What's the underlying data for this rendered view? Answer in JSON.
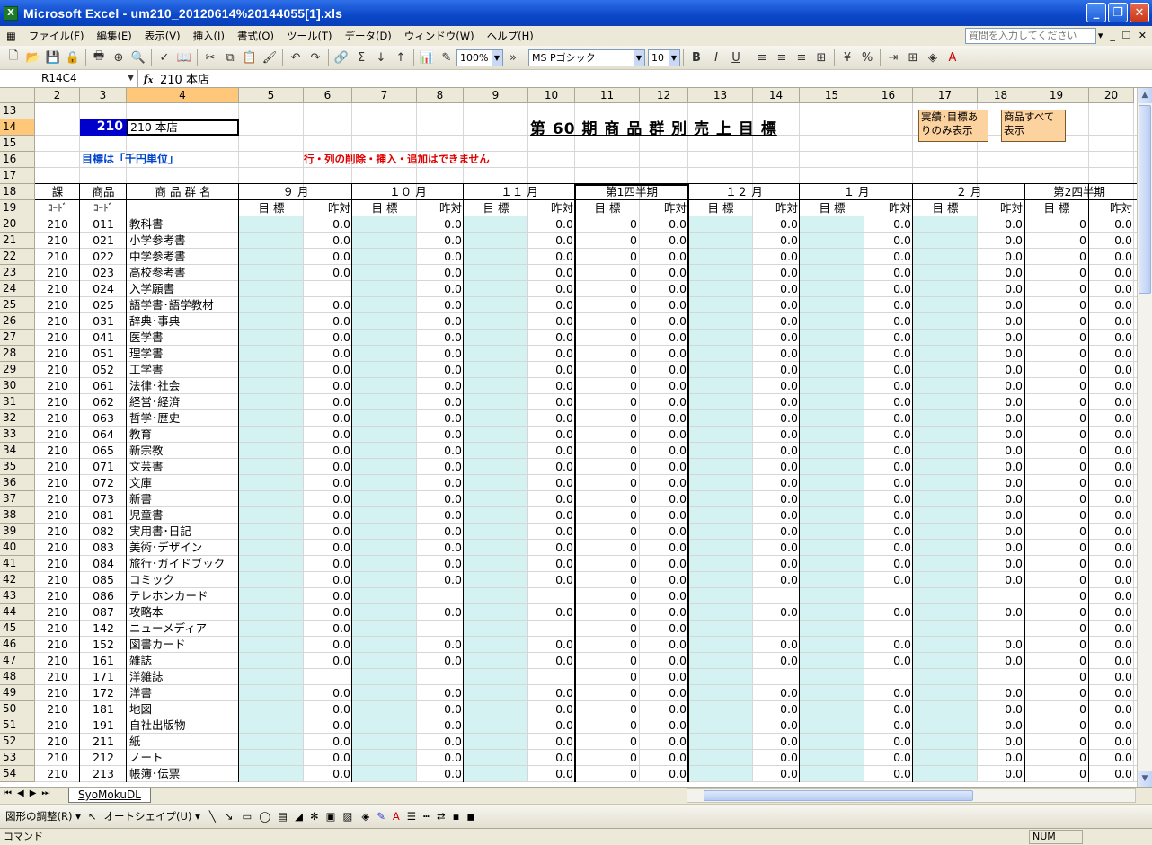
{
  "window": {
    "title": "Microsoft Excel - um210_20120614%20144055[1].xls",
    "app_icon": "excel-icon"
  },
  "menu": {
    "items": [
      "ファイル(F)",
      "編集(E)",
      "表示(V)",
      "挿入(I)",
      "書式(O)",
      "ツール(T)",
      "データ(D)",
      "ウィンドウ(W)",
      "ヘルプ(H)"
    ],
    "ask_placeholder": "質問を入力してください"
  },
  "toolbar": {
    "zoom": "100%",
    "font": "MS Pゴシック",
    "size": "10"
  },
  "formula": {
    "name_box": "R14C4",
    "fx": "fx",
    "value": "210  本店"
  },
  "columns": [
    "2",
    "3",
    "4",
    "5",
    "6",
    "7",
    "8",
    "9",
    "10",
    "11",
    "12",
    "13",
    "14",
    "15",
    "16",
    "17",
    "18",
    "19",
    "20"
  ],
  "sheet": {
    "store_code": "210",
    "store_name": "210  本店",
    "title": "第 60 期   商 品 群 別 売 上 目 標",
    "unit_note": "目標は「千円単位」",
    "warning": "行・列の削除・挿入・追加はできません",
    "button1": "実績･目標あ りのみ表示",
    "button2": "商品すべて 表示",
    "head1": {
      "ka": "課",
      "shohin": "商品",
      "group": "商 品 群 名",
      "m9": "９ 月",
      "m10": "１０ 月",
      "m11": "１１ 月",
      "q1": "第1四半期",
      "m12": "１２ 月",
      "m1": "１ 月",
      "m2": "２ 月",
      "q2": "第2四半期"
    },
    "head2": {
      "code1": "ｺｰﾄﾞ",
      "code2": "ｺｰﾄﾞ",
      "target": "目 標",
      "yoy": "昨対"
    },
    "rows": [
      {
        "r": "20",
        "ka": "210",
        "code": "011",
        "name": "教科書"
      },
      {
        "r": "21",
        "ka": "210",
        "code": "021",
        "name": "小学参考書"
      },
      {
        "r": "22",
        "ka": "210",
        "code": "022",
        "name": "中学参考書"
      },
      {
        "r": "23",
        "ka": "210",
        "code": "023",
        "name": "高校参考書"
      },
      {
        "r": "24",
        "ka": "210",
        "code": "024",
        "name": "入学願書"
      },
      {
        "r": "25",
        "ka": "210",
        "code": "025",
        "name": "語学書･語学教材"
      },
      {
        "r": "26",
        "ka": "210",
        "code": "031",
        "name": "辞典･事典"
      },
      {
        "r": "27",
        "ka": "210",
        "code": "041",
        "name": "医学書"
      },
      {
        "r": "28",
        "ka": "210",
        "code": "051",
        "name": "理学書"
      },
      {
        "r": "29",
        "ka": "210",
        "code": "052",
        "name": "工学書"
      },
      {
        "r": "30",
        "ka": "210",
        "code": "061",
        "name": "法律･社会"
      },
      {
        "r": "31",
        "ka": "210",
        "code": "062",
        "name": "経営･経済"
      },
      {
        "r": "32",
        "ka": "210",
        "code": "063",
        "name": "哲学･歴史"
      },
      {
        "r": "33",
        "ka": "210",
        "code": "064",
        "name": "教育"
      },
      {
        "r": "34",
        "ka": "210",
        "code": "065",
        "name": "新宗教"
      },
      {
        "r": "35",
        "ka": "210",
        "code": "071",
        "name": "文芸書"
      },
      {
        "r": "36",
        "ka": "210",
        "code": "072",
        "name": "文庫"
      },
      {
        "r": "37",
        "ka": "210",
        "code": "073",
        "name": "新書"
      },
      {
        "r": "38",
        "ka": "210",
        "code": "081",
        "name": "児童書"
      },
      {
        "r": "39",
        "ka": "210",
        "code": "082",
        "name": "実用書･日記"
      },
      {
        "r": "40",
        "ka": "210",
        "code": "083",
        "name": "美術･デザイン"
      },
      {
        "r": "41",
        "ka": "210",
        "code": "084",
        "name": "旅行･ガイドブック"
      },
      {
        "r": "42",
        "ka": "210",
        "code": "085",
        "name": "コミック"
      },
      {
        "r": "43",
        "ka": "210",
        "code": "086",
        "name": "テレホンカード"
      },
      {
        "r": "44",
        "ka": "210",
        "code": "087",
        "name": "攻略本"
      },
      {
        "r": "45",
        "ka": "210",
        "code": "142",
        "name": "ニューメディア"
      },
      {
        "r": "46",
        "ka": "210",
        "code": "152",
        "name": "図書カード"
      },
      {
        "r": "47",
        "ka": "210",
        "code": "161",
        "name": "雑誌"
      },
      {
        "r": "48",
        "ka": "210",
        "code": "171",
        "name": "洋雑誌"
      },
      {
        "r": "49",
        "ka": "210",
        "code": "172",
        "name": "洋書"
      },
      {
        "r": "50",
        "ka": "210",
        "code": "181",
        "name": "地図"
      },
      {
        "r": "51",
        "ka": "210",
        "code": "191",
        "name": "自社出版物"
      },
      {
        "r": "52",
        "ka": "210",
        "code": "211",
        "name": "紙"
      },
      {
        "r": "53",
        "ka": "210",
        "code": "212",
        "name": "ノート"
      },
      {
        "r": "54",
        "ka": "210",
        "code": "213",
        "name": "帳簿･伝票"
      }
    ],
    "zero_decimal": "0.0",
    "zero_int": "0"
  },
  "tabs": {
    "sheet": "SyoMokuDL"
  },
  "drawbar": {
    "adjust": "図形の調整(R) ▾",
    "autoshape": "オートシェイプ(U) ▾"
  },
  "status": {
    "mode": "コマンド",
    "num": "NUM"
  }
}
